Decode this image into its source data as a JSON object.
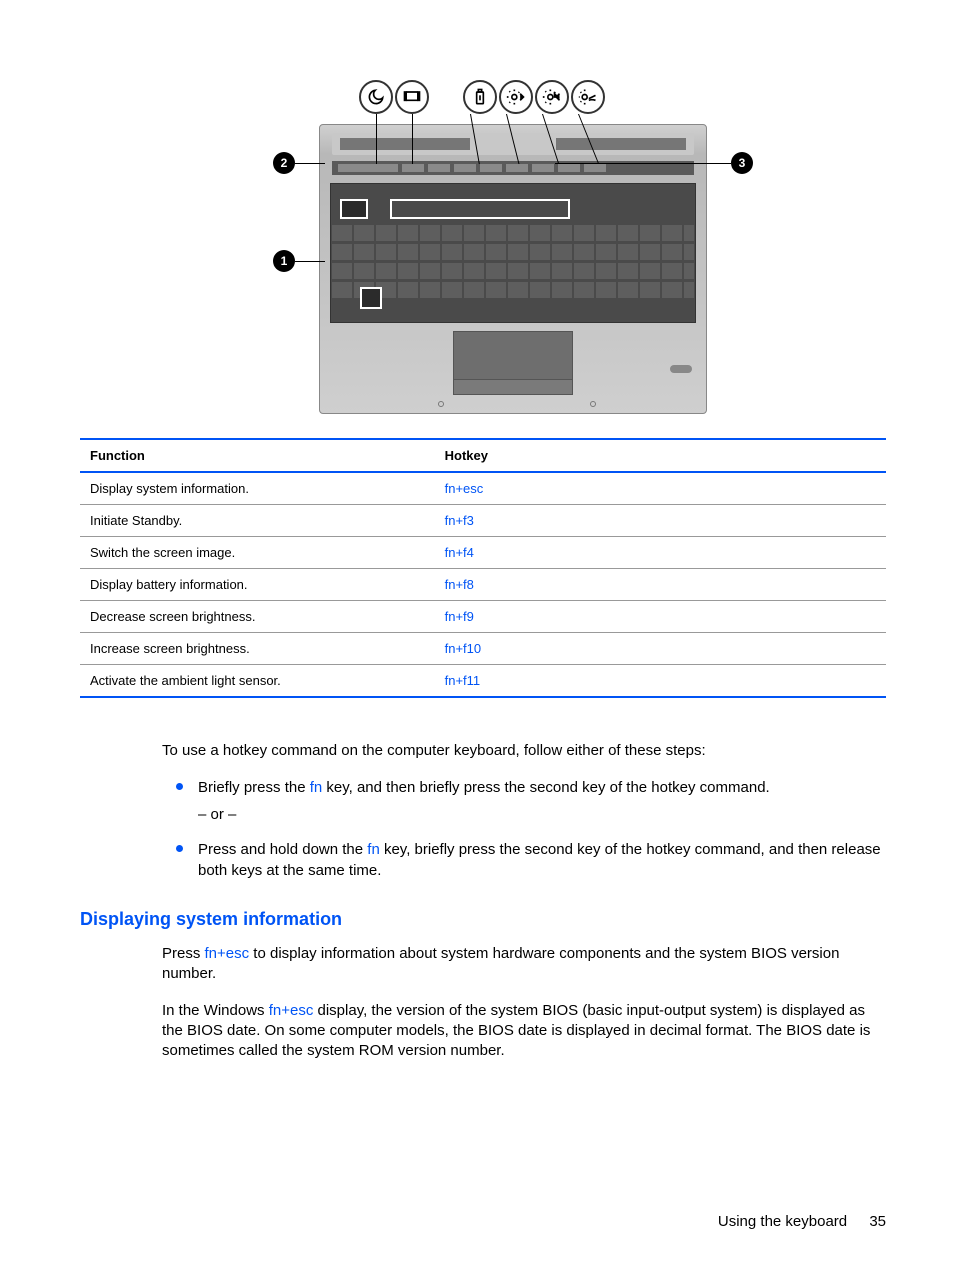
{
  "table": {
    "headers": {
      "func": "Function",
      "hotkey": "Hotkey"
    },
    "rows": [
      {
        "func": "Display system information.",
        "hotkey": "fn+esc"
      },
      {
        "func": "Initiate Standby.",
        "hotkey": "fn+f3"
      },
      {
        "func": "Switch the screen image.",
        "hotkey": "fn+f4"
      },
      {
        "func": "Display battery information.",
        "hotkey": "fn+f8"
      },
      {
        "func": "Decrease screen brightness.",
        "hotkey": "fn+f9"
      },
      {
        "func": "Increase screen brightness.",
        "hotkey": "fn+f10"
      },
      {
        "func": "Activate the ambient light sensor.",
        "hotkey": "fn+f11"
      }
    ]
  },
  "intro": "To use a hotkey command on the computer keyboard, follow either of these steps:",
  "steps": {
    "s1a": "Briefly press the ",
    "s1_fn": "fn",
    "s1b": " key, and then briefly press the second key of the hotkey command.",
    "or": "– or –",
    "s2a": "Press and hold down the ",
    "s2_fn": "fn",
    "s2b": " key, briefly press the second key of the hotkey command, and then release both keys at the same time."
  },
  "section_heading": "Displaying system information",
  "p1a": "Press ",
  "p1_key": "fn+esc",
  "p1b": " to display information about system hardware components and the system BIOS version number.",
  "p2a": "In the Windows ",
  "p2_key": "fn+esc",
  "p2b": " display, the version of the system BIOS (basic input-output system) is displayed as the BIOS date. On some computer models, the BIOS date is displayed in decimal format. The BIOS date is sometimes called the system ROM version number.",
  "callouts": {
    "c1": "1",
    "c2": "2",
    "c3": "3"
  },
  "footer": {
    "section": "Using the keyboard",
    "page": "35"
  }
}
